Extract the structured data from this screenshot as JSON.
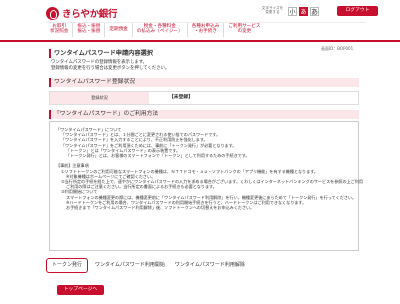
{
  "header": {
    "bank_name": "きらやか銀行",
    "font_size_label_1": "文字サイズを",
    "font_size_label_2": "変更する",
    "font_buttons": [
      "小",
      "あ",
      "あ"
    ],
    "logout": "ログアウト",
    "nav": [
      [
        "お取引",
        "状況照会"
      ],
      [
        "振込・振替",
        "振込・振替"
      ],
      [
        "定期預金",
        ""
      ],
      [
        "税金・各種料金",
        "の払込み（ペイジー）"
      ],
      [
        "各種お申込み",
        "・お手続き"
      ],
      [
        "ご利用サービス",
        "の変更"
      ]
    ]
  },
  "screen_id": "画面ID：BOP001",
  "page_title": "ワンタイムパスワード申請内容選択",
  "intro": [
    "ワンタイムパスワードの登録情報を表示します。",
    "登録情報の変更を行う場合は変更ボタンを押してください。"
  ],
  "reg_section_title": "ワンタイムパスワード登録状況",
  "reg_status": {
    "label": "登録状況",
    "value": "【未登録】"
  },
  "usage_section_title": "「ワンタイムパスワード」のご利用方法",
  "info": [
    {
      "cls": "p",
      "text": "「ワンタイムパスワード」について"
    },
    {
      "cls": "p ind",
      "text": "「ワンタイムパスワード」とは、１分間ごとに変更される使い捨てのパスワードです。"
    },
    {
      "cls": "p ind",
      "text": "「ワンタイムパスワード」を入力することにより、不正利用防止を強化します。"
    },
    {
      "cls": "p ind",
      "text": "「ワンタイムパスワード」をご利用頂くためには、事前に「トークン発行」が必要となります。"
    },
    {
      "cls": "p ind2",
      "text": "「トークン」とは「ワンタイムパスワード」の表示装置です。"
    },
    {
      "cls": "p ind2",
      "text": "「トークン発行」とは、お客様のスマートフォンで「トークン」として利用するための手続きです。"
    },
    {
      "cls": "p",
      "text": ""
    },
    {
      "cls": "p",
      "text": "【事前】注意事項"
    },
    {
      "cls": "p ind",
      "text": "①ソフトトークンのご利用可能なスマートフォンの機種は、ＮＴＴドコモ・ａｕ・ソフトバンクの「アプリ機能」を有する機種となります。"
    },
    {
      "cls": "p ind2",
      "text": "※対象機種はホームページにてご確認ください。"
    },
    {
      "cls": "p ind",
      "text": "②当行所定の手続を経た上で、速やかにワンタイムパスワードの入力を求める場合がございます。くわしくはインターネットバンキングのサービスを参照の上ご利用"
    },
    {
      "cls": "p ind2",
      "text": "ご利用の際はご注意ください。当行所定の書面によるお手続きも必要となります。"
    },
    {
      "cls": "p ind",
      "text": "③利用開始について"
    },
    {
      "cls": "p ind2",
      "text": "スマートフォンの機種変更の際には、機種変更前に「ワンタイムパスワード利用解除」を行い、機種変更後にあらためて「トークン発行」を行ってください。"
    },
    {
      "cls": "p ind2",
      "text": "※ハードトークンをご利用の場合、ワンタイムパスワードの利用開始手続きを行うと、ハードトークンはご利用できなくなります。"
    },
    {
      "cls": "p ind2",
      "text": "お手続きまで「ワンタイムパスワード利用解除」後、ソフトトークンへの切替えをお申込みください。"
    }
  ],
  "tabs": [
    "トークン発行",
    "ワンタイムパスワード利用開始",
    "ワンタイムパスワード利用解除"
  ],
  "top_button": "トップページへ"
}
